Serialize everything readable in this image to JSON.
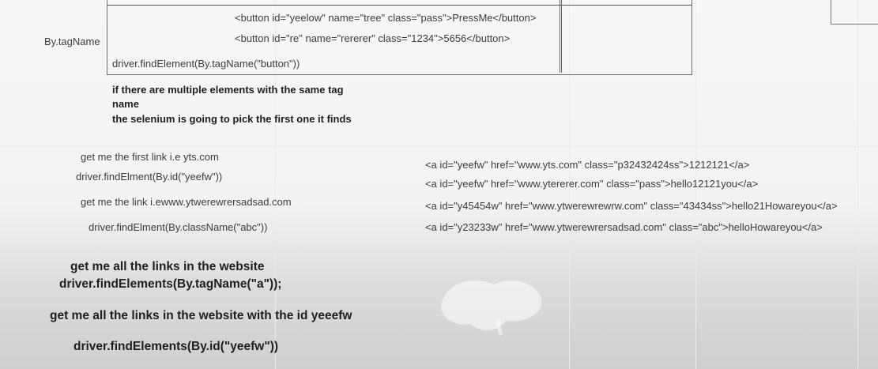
{
  "whiteboard": {
    "left_label": "By.tagName",
    "box": {
      "button1": "<button id=\"yeelow\" name=\"tree\" class=\"pass\">PressMe</button>",
      "button2": "<button id=\"re\" name=\"rererer\" class=\"1234\">5656</button>",
      "find_code": "driver.findElement(By.tagName(\"button\"))"
    },
    "note": {
      "line1": "if there are multiple elements with the same tag",
      "line2": "name",
      "line3": "the selenium is going to pick the first one it finds"
    },
    "left_notes": {
      "first_link": "get me the first link i.e yts.com",
      "find_by_id": "driver.findElment(By.id(\"yeefw\"))",
      "link_text": "get me the   link i.ewww.ytwerewrersadsad.com",
      "find_by_class": "driver.findElment(By.className(\"abc\"))"
    },
    "anchors": [
      "<a id=\"yeefw\" href=\"www.yts.com\" class=\"p32432424ss\">1212121</a>",
      "<a id=\"yeefw\" href=\"www.ytererer.com\" class=\"pass\">hello12121you</a>",
      "<a id=\"y45454w\" href=\"www.ytwerewrewrw.com\" class=\"43434ss\">hello21Howareyou</a>",
      "<a id=\"y23233w\" href=\"www.ytwerewrersadsad.com\" class=\"abc\">helloHowareyou</a>"
    ],
    "bottom": {
      "all_links": "get me all the links in the website",
      "find_all_tag": "driver.findElements(By.tagName(\"a\"));",
      "all_links_id": "get me all the links in the website with the id yeeefw",
      "find_all_id": "driver.findElements(By.id(\"yeefw\"))"
    }
  }
}
